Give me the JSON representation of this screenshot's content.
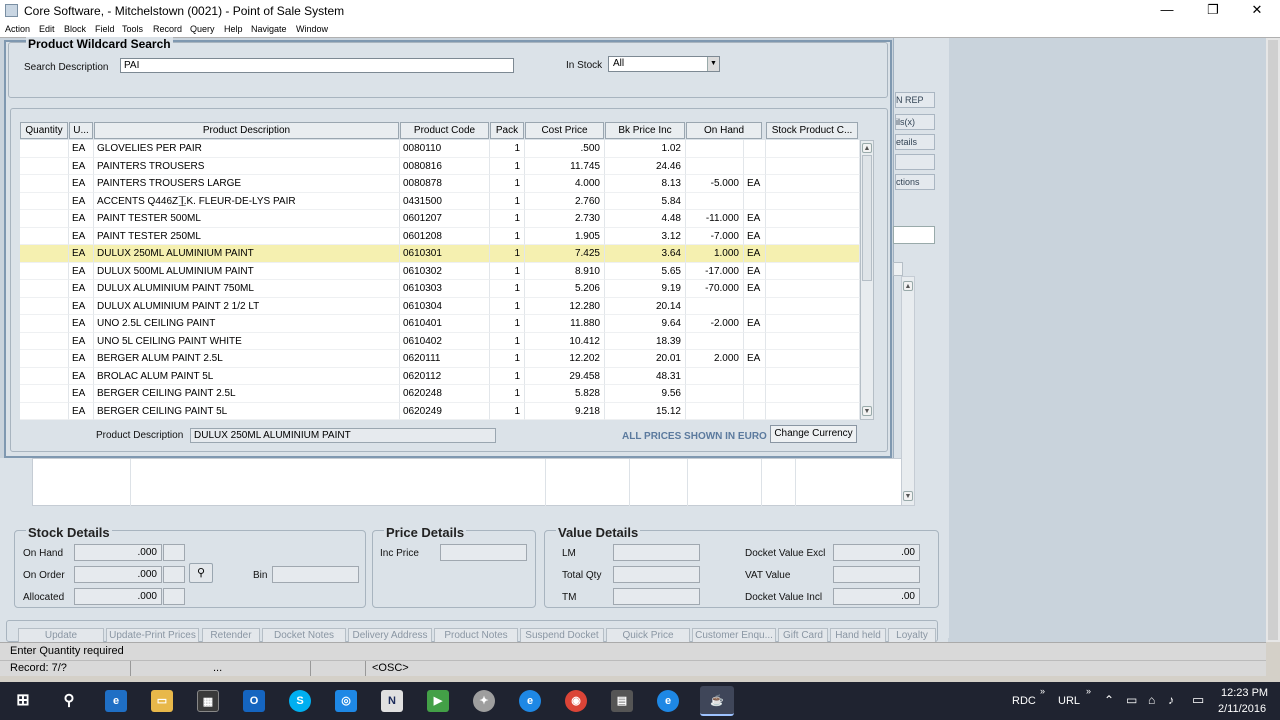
{
  "window": {
    "title": "Core Software,  -  Mitchelstown (0021)  -  Point of Sale System",
    "minimize": "—",
    "restore": "❐",
    "close": "✕"
  },
  "menu": [
    "Action",
    "Edit",
    "Block",
    "Field",
    "Tools",
    "Record",
    "Query",
    "Help",
    "Navigate",
    "Window"
  ],
  "right_panel_buttons": [
    "N REP",
    "ils(x)",
    "etails",
    "",
    "ctions"
  ],
  "search": {
    "title": "Product Wildcard Search",
    "desc_label": "Search Description",
    "desc_value": "PAI",
    "stock_label": "In Stock",
    "stock_value": "All"
  },
  "grid": {
    "headers": [
      "Quantity",
      "U...",
      "Product Description",
      "Product Code",
      "Pack",
      "Cost Price",
      "Bk Price Inc",
      "On Hand",
      "",
      "Stock Product C..."
    ],
    "rows": [
      {
        "u": "EA",
        "desc": "GLOVELIES PER PAIR",
        "code": "0080110",
        "pack": "1",
        "cost": ".500",
        "bk": "1.02",
        "onhand": "",
        "unit": ""
      },
      {
        "u": "EA",
        "desc": "PAINTERS TROUSERS",
        "code": "0080816",
        "pack": "1",
        "cost": "11.745",
        "bk": "24.46",
        "onhand": "",
        "unit": ""
      },
      {
        "u": "EA",
        "desc": "PAINTERS TROUSERS LARGE",
        "code": "0080878",
        "pack": "1",
        "cost": "4.000",
        "bk": "8.13",
        "onhand": "-5.000",
        "unit": "EA"
      },
      {
        "u": "EA",
        "desc": "ACCENTS Q446Z I.K. FLEUR-DE-LYS PAIR",
        "code": "0431500",
        "pack": "1",
        "cost": "2.760",
        "bk": "5.84",
        "onhand": "",
        "unit": ""
      },
      {
        "u": "EA",
        "desc": "PAINT TESTER 500ML",
        "code": "0601207",
        "pack": "1",
        "cost": "2.730",
        "bk": "4.48",
        "onhand": "-11.000",
        "unit": "EA"
      },
      {
        "u": "EA",
        "desc": "PAINT TESTER 250ML",
        "code": "0601208",
        "pack": "1",
        "cost": "1.905",
        "bk": "3.12",
        "onhand": "-7.000",
        "unit": "EA"
      },
      {
        "u": "EA",
        "desc": "DULUX 250ML ALUMINIUM PAINT",
        "code": "0610301",
        "pack": "1",
        "cost": "7.425",
        "bk": "3.64",
        "onhand": "1.000",
        "unit": "EA"
      },
      {
        "u": "EA",
        "desc": "DULUX 500ML ALUMINIUM PAINT",
        "code": "0610302",
        "pack": "1",
        "cost": "8.910",
        "bk": "5.65",
        "onhand": "-17.000",
        "unit": "EA"
      },
      {
        "u": "EA",
        "desc": "DULUX ALUMINIUM PAINT 750ML",
        "code": "0610303",
        "pack": "1",
        "cost": "5.206",
        "bk": "9.19",
        "onhand": "-70.000",
        "unit": "EA"
      },
      {
        "u": "EA",
        "desc": "DULUX  ALUMINIUM PAINT 2 1/2 LT",
        "code": "0610304",
        "pack": "1",
        "cost": "12.280",
        "bk": "20.14",
        "onhand": "",
        "unit": ""
      },
      {
        "u": "EA",
        "desc": "UNO 2.5L CEILING PAINT",
        "code": "0610401",
        "pack": "1",
        "cost": "11.880",
        "bk": "9.64",
        "onhand": "-2.000",
        "unit": "EA"
      },
      {
        "u": "EA",
        "desc": "UNO 5L CEILING PAINT WHITE",
        "code": "0610402",
        "pack": "1",
        "cost": "10.412",
        "bk": "18.39",
        "onhand": "",
        "unit": ""
      },
      {
        "u": "EA",
        "desc": "BERGER ALUM PAINT 2.5L",
        "code": "0620111",
        "pack": "1",
        "cost": "12.202",
        "bk": "20.01",
        "onhand": "2.000",
        "unit": "EA"
      },
      {
        "u": "EA",
        "desc": "BROLAC ALUM PAINT 5L",
        "code": "0620112",
        "pack": "1",
        "cost": "29.458",
        "bk": "48.31",
        "onhand": "",
        "unit": ""
      },
      {
        "u": "EA",
        "desc": "BERGER CEILING PAINT 2.5L",
        "code": "0620248",
        "pack": "1",
        "cost": "5.828",
        "bk": "9.56",
        "onhand": "",
        "unit": ""
      },
      {
        "u": "EA",
        "desc": "BERGER CEILING PAINT 5L",
        "code": "0620249",
        "pack": "1",
        "cost": "9.218",
        "bk": "15.12",
        "onhand": "",
        "unit": ""
      }
    ],
    "selected_index": 6
  },
  "footer": {
    "desc_label": "Product Description",
    "desc_value": "DULUX 250ML ALUMINIUM PAINT",
    "prices_note": "ALL PRICES SHOWN IN EURO",
    "change_currency": "Change Currency"
  },
  "stock_details": {
    "title": "Stock Details",
    "on_hand_label": "On Hand",
    "on_hand": ".000",
    "on_order_label": "On Order",
    "on_order": ".000",
    "allocated_label": "Allocated",
    "allocated": ".000",
    "bin_label": "Bin"
  },
  "price_details": {
    "title": "Price Details",
    "inc_price_label": "Inc Price"
  },
  "value_details": {
    "title": "Value Details",
    "lm_label": "LM",
    "total_qty_label": "Total Qty",
    "tm_label": "TM",
    "docket_excl_label": "Docket Value Excl",
    "docket_excl": ".00",
    "vat_label": "VAT Value",
    "docket_incl_label": "Docket Value Incl",
    "docket_incl": ".00"
  },
  "bottom_buttons": [
    "Update",
    "Update-Print Prices",
    "Retender",
    "Docket Notes",
    "Delivery Address",
    "Product Notes",
    "Suspend Docket",
    "Quick Price",
    "Customer Enqu...",
    "Gift Card",
    "Hand held",
    "Loyalty"
  ],
  "status": {
    "message": "Enter Quantity required",
    "record": "Record: 7/?",
    "dots": "...",
    "osc": "<OSC>"
  },
  "taskbar": {
    "icons": [
      "windows-start",
      "search",
      "edge",
      "file-explorer",
      "store",
      "outlook",
      "skype",
      "app-blue",
      "app-n",
      "app-green",
      "app-gray",
      "ie",
      "chrome",
      "media",
      "ie-2",
      "java"
    ],
    "tray_rdc": "RDC",
    "tray_url": "URL",
    "time": "12:23 PM",
    "date": "2/11/2016"
  }
}
